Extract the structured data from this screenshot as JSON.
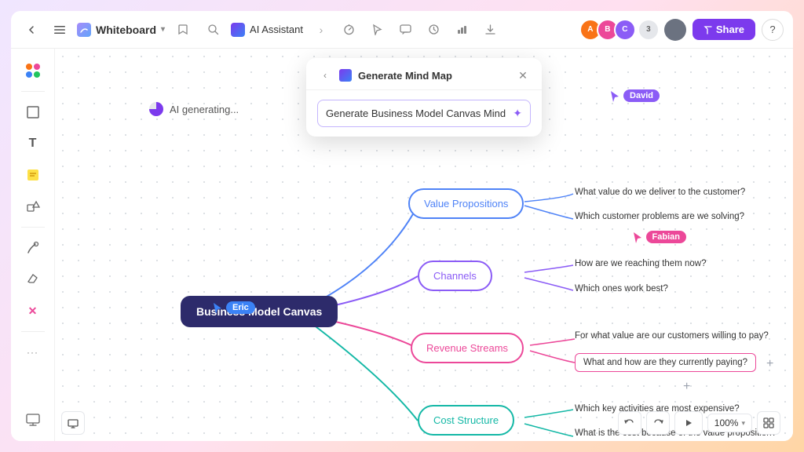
{
  "topbar": {
    "back_label": "←",
    "menu_label": "☰",
    "whiteboard_title": "Whiteboard",
    "chevron_label": "▾",
    "bookmark_icon": "🔖",
    "search_icon": "🔍",
    "ai_assistant_label": "AI Assistant",
    "divider_icons": [
      ">",
      "⏱",
      "🖱",
      "💬",
      "⏰",
      "📊",
      "⬇"
    ],
    "share_label": "Share",
    "help_label": "?"
  },
  "popup": {
    "title": "Generate Mind Map",
    "close_label": "✕",
    "input_value": "Generate Business Model Canvas Mind Map",
    "input_icon": "✦"
  },
  "mindmap": {
    "central_node": "Business Model Canvas",
    "ai_generating": "AI generating...",
    "nodes": [
      {
        "id": "value-props",
        "label": "Value Propositions",
        "type": "blue"
      },
      {
        "id": "channels",
        "label": "Channels",
        "type": "purple"
      },
      {
        "id": "revenue-streams",
        "label": "Revenue Streams",
        "type": "pink"
      },
      {
        "id": "cost-structure",
        "label": "Cost Structure",
        "type": "teal"
      }
    ],
    "leaves": [
      {
        "id": "vp1",
        "text": "What value do we deliver to the customer?"
      },
      {
        "id": "vp2",
        "text": "Which customer problems are we solving?"
      },
      {
        "id": "ch1",
        "text": "How are we reaching them now?"
      },
      {
        "id": "ch2",
        "text": "Which ones work best?"
      },
      {
        "id": "rs1",
        "text": "For what value are our customers willing to pay?"
      },
      {
        "id": "rs2_box",
        "text": "What and how are they currently paying?"
      },
      {
        "id": "cs1",
        "text": "Which key activities are most expensive?"
      },
      {
        "id": "cs2",
        "text": "What is the cost because of the value proposition?"
      }
    ]
  },
  "cursors": [
    {
      "id": "david",
      "name": "David",
      "color": "#8b5cf6"
    },
    {
      "id": "eric",
      "name": "Eric",
      "color": "#3b82f6"
    },
    {
      "id": "fabian",
      "name": "Fabian",
      "color": "#ec4899"
    }
  ],
  "zoom": {
    "level": "100%"
  },
  "sidebar_tools": [
    {
      "id": "palette",
      "icon": "🎨"
    },
    {
      "id": "frame",
      "icon": "⬜"
    },
    {
      "id": "text",
      "icon": "T"
    },
    {
      "id": "sticky",
      "icon": "🟨"
    },
    {
      "id": "shapes",
      "icon": "⬡"
    },
    {
      "id": "pen",
      "icon": "✒"
    },
    {
      "id": "eraser",
      "icon": "✏"
    },
    {
      "id": "connector",
      "icon": "✕"
    },
    {
      "id": "more",
      "icon": "..."
    }
  ]
}
